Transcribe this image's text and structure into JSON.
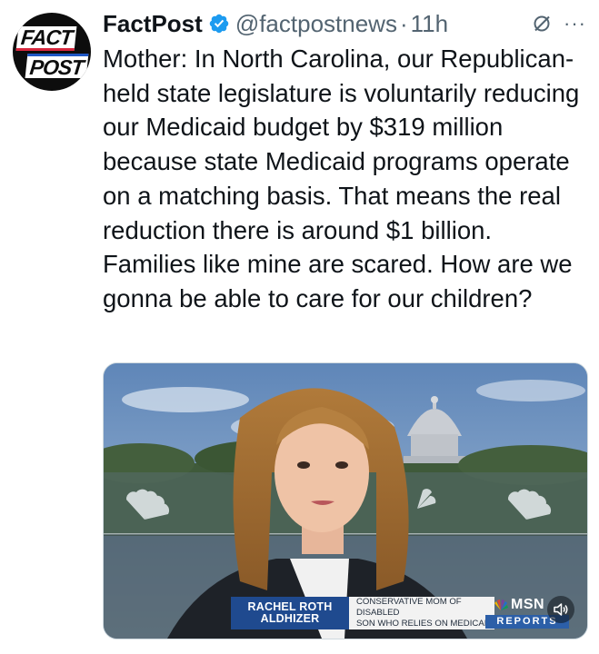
{
  "account": {
    "name": "FactPost",
    "handle": "@factpostnews",
    "separator": "·",
    "time": "11h",
    "verified": true,
    "avatar_icon": "factpost-logo",
    "avatar_words": [
      "FACT",
      "POST"
    ]
  },
  "header_actions": {
    "grok_icon": "grok-icon",
    "more_icon": "more-icon",
    "more_label": "···"
  },
  "tweet": {
    "text": "Mother: In North Carolina, our Republican-held state legislature is voluntarily reducing our Medicaid budget by $319 million because state Medicaid programs operate on a matching basis. That means the real reduction there is around $1 billion. Families like mine are scared. How are we gonna be able to care for our children?"
  },
  "media": {
    "type": "video",
    "lower_third": {
      "name_line1": "RACHEL ROTH",
      "name_line2": "ALDHIZER",
      "desc_line1": "CONSERVATIVE MOM OF DISABLED",
      "desc_line2": "SON WHO RELIES ON MEDICAID"
    },
    "network": {
      "brand": "MSN",
      "show": "REPORTS"
    },
    "sound_icon": "sound-icon"
  },
  "colors": {
    "text": "#0f1419",
    "secondary": "#536471",
    "verified_blue": "#1d9bf0",
    "lower_third_blue": "#1f4a8f"
  }
}
